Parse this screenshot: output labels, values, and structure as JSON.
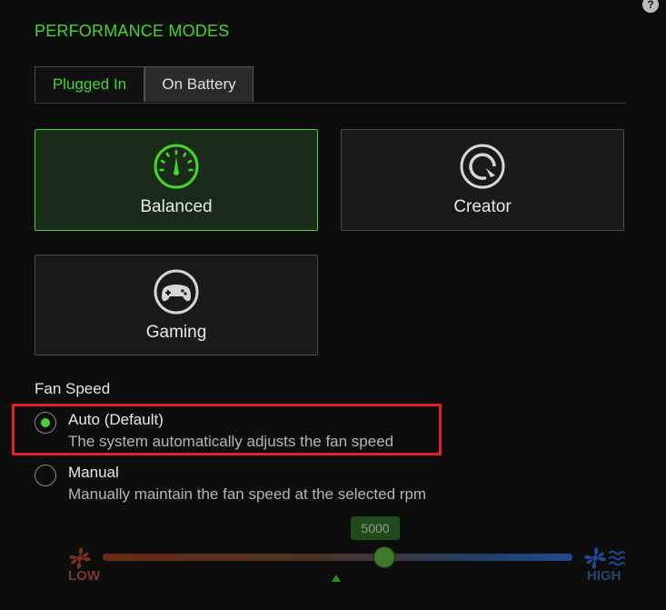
{
  "header": {
    "help_label": "?",
    "section_title": "PERFORMANCE MODES"
  },
  "tabs": [
    {
      "label": "Plugged In",
      "selected": true
    },
    {
      "label": "On Battery",
      "selected": false
    }
  ],
  "modes": {
    "balanced": {
      "label": "Balanced",
      "icon": "speedometer-icon",
      "selected": true
    },
    "creator": {
      "label": "Creator",
      "icon": "creator-dial-icon",
      "selected": false
    },
    "gaming": {
      "label": "Gaming",
      "icon": "gamepad-icon",
      "selected": false
    }
  },
  "fan": {
    "title": "Fan Speed",
    "auto": {
      "title": "Auto (Default)",
      "desc": "The system automatically adjusts the fan speed",
      "checked": true
    },
    "manual": {
      "title": "Manual",
      "desc": "Manually maintain the fan speed at the selected rpm",
      "checked": false
    },
    "slider": {
      "value_label": "5000",
      "value_fraction": 0.6,
      "low_label": "LOW",
      "high_label": "HIGH"
    }
  },
  "colors": {
    "accent": "#44d62c",
    "highlight": "#e32028",
    "low": "#7a3a2a",
    "high": "#26456e"
  }
}
